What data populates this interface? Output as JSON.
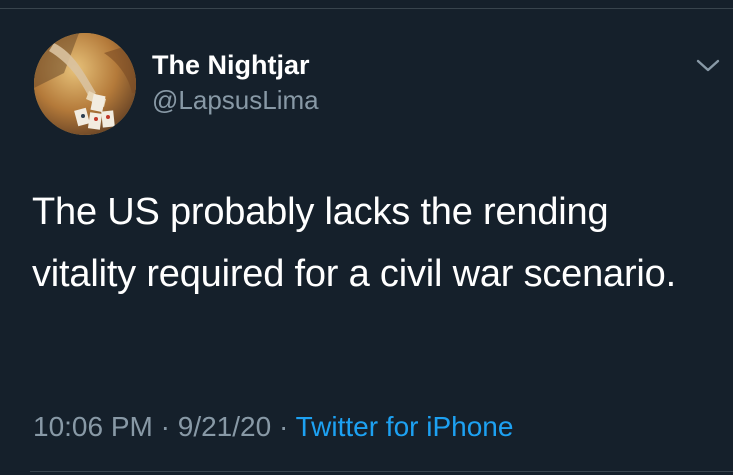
{
  "author": {
    "display_name": "The Nightjar",
    "handle": "@LapsusLima",
    "avatar": "tarot-cards-painting"
  },
  "tweet": {
    "text": "The US probably lacks the rending vitality required for a civil war scenario.",
    "time": "10:06 PM",
    "separator_1": "·",
    "date": "9/21/20",
    "separator_2": "·",
    "source": "Twitter for iPhone"
  },
  "icons": {
    "menu": "chevron-down-icon"
  },
  "colors": {
    "background": "#15202b",
    "primary_text": "#ffffff",
    "secondary_text": "#8899a6",
    "link": "#1da1f2",
    "divider": "#38444d"
  }
}
